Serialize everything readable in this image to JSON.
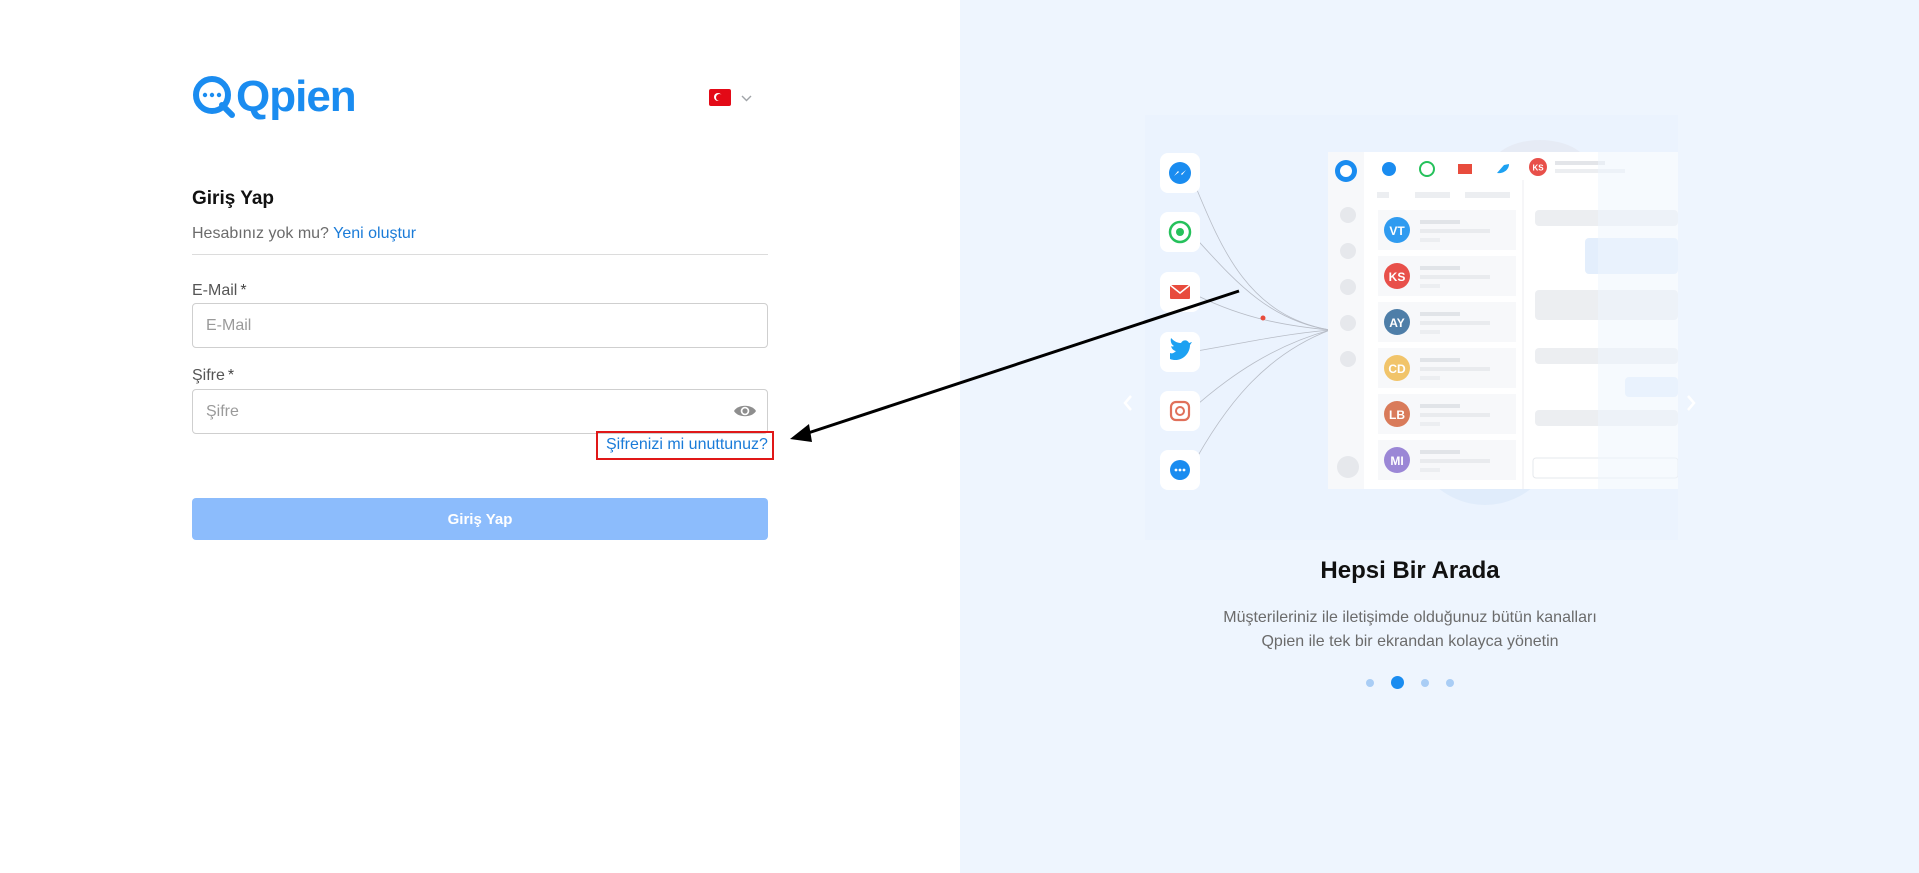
{
  "brand": {
    "name": "Qpien",
    "color": "#1a8cf0"
  },
  "language": {
    "flag": "turkey-flag",
    "current": "TR"
  },
  "login": {
    "title": "Giriş Yap",
    "no_account_text": "Hesabınız yok mu?",
    "create_link": "Yeni oluştur",
    "email_label": "E-Mail",
    "email_placeholder": "E-Mail",
    "password_label": "Şifre",
    "password_placeholder": "Şifre",
    "required_mark": "*",
    "forgot_password": "Şifrenizi mi unuttunuz?",
    "submit": "Giriş Yap"
  },
  "carousel": {
    "title": "Hepsi Bir Arada",
    "description_line1": "Müşterileriniz ile iletişimde olduğunuz bütün kanalları",
    "description_line2": "Qpien ile tek bir ekrandan kolayca yönetin",
    "active_index": 1,
    "slide_count": 4,
    "prev_icon": "chevron-left-icon",
    "next_icon": "chevron-right-icon"
  },
  "illustration": {
    "channels": [
      "messenger-icon",
      "whatsapp-icon",
      "email-icon",
      "twitter-icon",
      "instagram-icon",
      "livechat-icon"
    ],
    "contacts": [
      {
        "initials": "VT",
        "color": "#2f9bf0"
      },
      {
        "initials": "KS",
        "color": "#e8504a"
      },
      {
        "initials": "AY",
        "color": "#4e7ea8"
      },
      {
        "initials": "CD",
        "color": "#f1c46a"
      },
      {
        "initials": "LB",
        "color": "#d97b5a"
      },
      {
        "initials": "MI",
        "color": "#9b87d6"
      }
    ],
    "header_avatar": "KS"
  },
  "colors": {
    "accent": "#1a8cf0",
    "button_disabled": "#8cbcfc",
    "highlight_box": "#e01818",
    "right_panel_bg": "#eef5fe"
  }
}
